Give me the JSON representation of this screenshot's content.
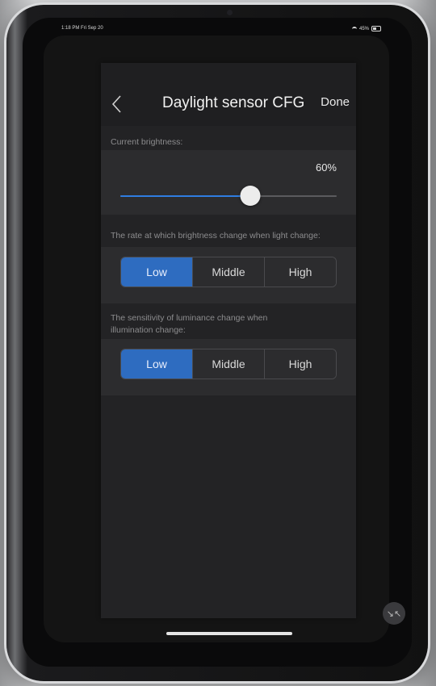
{
  "status_bar": {
    "time": "1:18 PM  Fri Sep 20",
    "battery": "45%"
  },
  "nav": {
    "title": "Daylight sensor CFG",
    "done_label": "Done"
  },
  "brightness": {
    "label": "Current brightness:",
    "value_text": "60%",
    "slider_value": 0.6
  },
  "rate": {
    "label": "The rate at which brightness change when light change:",
    "options": [
      "Low",
      "Middle",
      "High"
    ],
    "selected": "Low"
  },
  "sensitivity": {
    "label_line1": "The sensitivity of luminance change when",
    "label_line2": "illumination change:",
    "options": [
      "Low",
      "Middle",
      "High"
    ],
    "selected": "Low"
  },
  "colors": {
    "accent": "#2e6cc0",
    "slider_fill": "#2f7de1",
    "window_bg": "#232325"
  }
}
